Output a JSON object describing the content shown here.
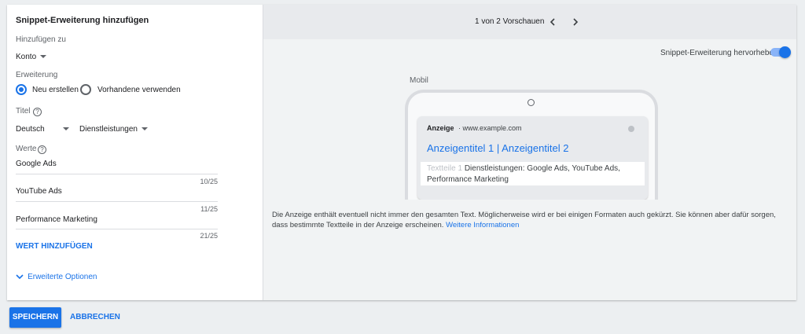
{
  "form": {
    "title": "Snippet-Erweiterung hinzufügen",
    "add_to_label": "Hinzufügen zu",
    "add_to_value": "Konto",
    "extension_label": "Erweiterung",
    "radio_new": "Neu erstellen",
    "radio_existing": "Vorhandene verwenden",
    "title_label": "Titel",
    "language": "Deutsch",
    "header_type": "Dienstleistungen",
    "values_label": "Werte",
    "values": [
      {
        "text": "Google Ads",
        "counter": "10/25"
      },
      {
        "text": "YouTube Ads",
        "counter": "11/25"
      },
      {
        "text": "Performance Marketing",
        "counter": "21/25"
      }
    ],
    "add_value": "WERT HINZUFÜGEN",
    "advanced": "Erweiterte Optionen"
  },
  "preview": {
    "pager": "1 von 2 Vorschauen",
    "highlight_label": "Snippet-Erweiterung hervorheben",
    "highlight_on": true,
    "device_label": "Mobil",
    "ad": {
      "badge": "Anzeige",
      "url": "· www.example.com",
      "headline": "Anzeigentitel 1 | Anzeigentitel 2",
      "desc_placeholder": "Textteile 1",
      "desc_text": "Dienstleistungen: Google Ads, YouTube Ads, Performance Marketing"
    },
    "disclaimer": "Die Anzeige enthält eventuell nicht immer den gesamten Text. Möglicherweise wird er bei einigen Formaten auch gekürzt. Sie können aber dafür sorgen, dass bestimmte Textteile in der Anzeige erscheinen.",
    "learn_more": "Weitere Informationen"
  },
  "actions": {
    "save": "SPEICHERN",
    "cancel": "ABBRECHEN"
  },
  "colors": {
    "accent": "#1a73e8",
    "background": "#eceff1"
  }
}
